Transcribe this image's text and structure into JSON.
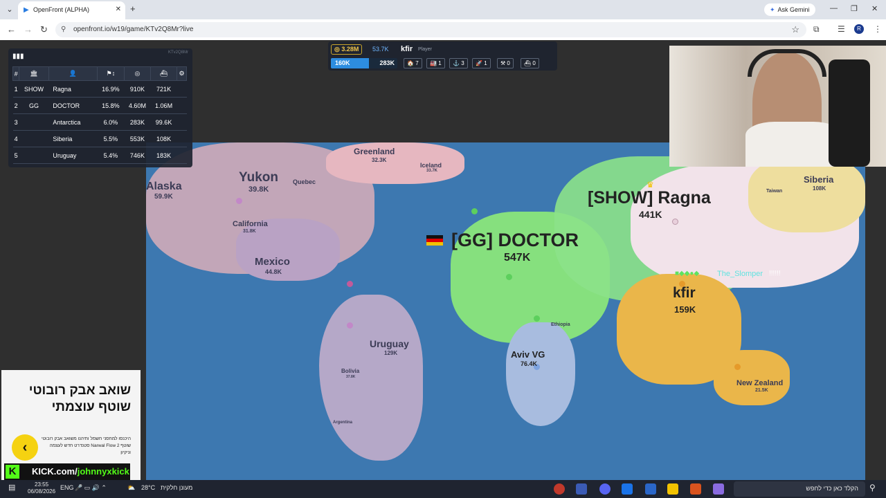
{
  "browser": {
    "tab_title": "OpenFront (ALPHA)",
    "url": "openfront.io/w19/game/KTv2Q8Mr?live",
    "ask_gemini": "Ask Gemini",
    "avatar_letter": "R"
  },
  "leaderboard": {
    "game_id": "KTv2Q8Mr",
    "columns": [
      "#",
      "🏛",
      "👤",
      "⚑↕",
      "◎",
      "⛴"
    ],
    "rows": [
      {
        "rank": "1",
        "clan": "SHOW",
        "name": "Ragna",
        "land": "16.9%",
        "gold": "910K",
        "troops": "721K"
      },
      {
        "rank": "2",
        "clan": "GG",
        "name": "DOCTOR",
        "land": "15.8%",
        "gold": "4.60M",
        "troops": "1.06M"
      },
      {
        "rank": "3",
        "clan": "",
        "name": "Antarctica",
        "land": "6.0%",
        "gold": "283K",
        "troops": "99.6K"
      },
      {
        "rank": "4",
        "clan": "",
        "name": "Siberia",
        "land": "5.5%",
        "gold": "553K",
        "troops": "108K"
      },
      {
        "rank": "5",
        "clan": "",
        "name": "Uruguay",
        "land": "5.4%",
        "gold": "746K",
        "troops": "183K"
      }
    ]
  },
  "player_bar": {
    "gold": "3.28M",
    "troop_rate": "53.7K",
    "name": "kfir",
    "role": "Player",
    "pop_current": "160K",
    "pop_max": "283K",
    "pop_fraction": 0.57,
    "buildings": [
      {
        "icon": "🏠",
        "count": "7"
      },
      {
        "icon": "🏭",
        "count": "1"
      },
      {
        "icon": "⚓",
        "count": "3"
      },
      {
        "icon": "🚀",
        "count": "1"
      },
      {
        "icon": "⚒",
        "count": "0"
      },
      {
        "icon": "⛴",
        "count": "0"
      }
    ]
  },
  "map": {
    "labels": [
      {
        "name": "Greenland",
        "value": "32.3K"
      },
      {
        "name": "Iceland",
        "value": "33.7K"
      },
      {
        "name": "Yukon",
        "value": "39.8K"
      },
      {
        "name": "Quebec",
        "value": ""
      },
      {
        "name": "Alaska",
        "value": "59.9K"
      },
      {
        "name": "California",
        "value": "31.8K"
      },
      {
        "name": "Mexico",
        "value": "44.8K"
      },
      {
        "name": "[GG] DOCTOR",
        "value": "547K"
      },
      {
        "name": "[SHOW] Ragna",
        "value": "441K"
      },
      {
        "name": "Siberia",
        "value": "108K"
      },
      {
        "name": "Taiwan",
        "value": ""
      },
      {
        "name": "kfir",
        "value": "159K"
      },
      {
        "name": "The_Slomper",
        "value": "!!!!!!"
      },
      {
        "name": "Uruguay",
        "value": "129K"
      },
      {
        "name": "Aviv VG",
        "value": "76.4K"
      },
      {
        "name": "Ethiopia",
        "value": ""
      },
      {
        "name": "Bolivia",
        "value": "37.8K"
      },
      {
        "name": "Argentina",
        "value": ""
      },
      {
        "name": "New Zealand",
        "value": "21.5K"
      }
    ]
  },
  "ad": {
    "headline_1": "שואב אבק רובוטי",
    "headline_2": "שוטף עוצמתי",
    "body": "היכנסו למחסני חשמל ותיהנו משואב אבק רובוטי שוטף Narwal Flow 2 סטנדרט חדש לעצמה וניקיון",
    "kick_prefix": "KICK.com/",
    "kick_user": "johnnyxkick"
  },
  "taskbar": {
    "time": "23:55",
    "date": "06/08/2026",
    "lang": "ENG",
    "weather_temp": "28°C",
    "weather_desc": "מעונן חלקית",
    "search_placeholder": "הקלד כאן כדי לחפש"
  }
}
